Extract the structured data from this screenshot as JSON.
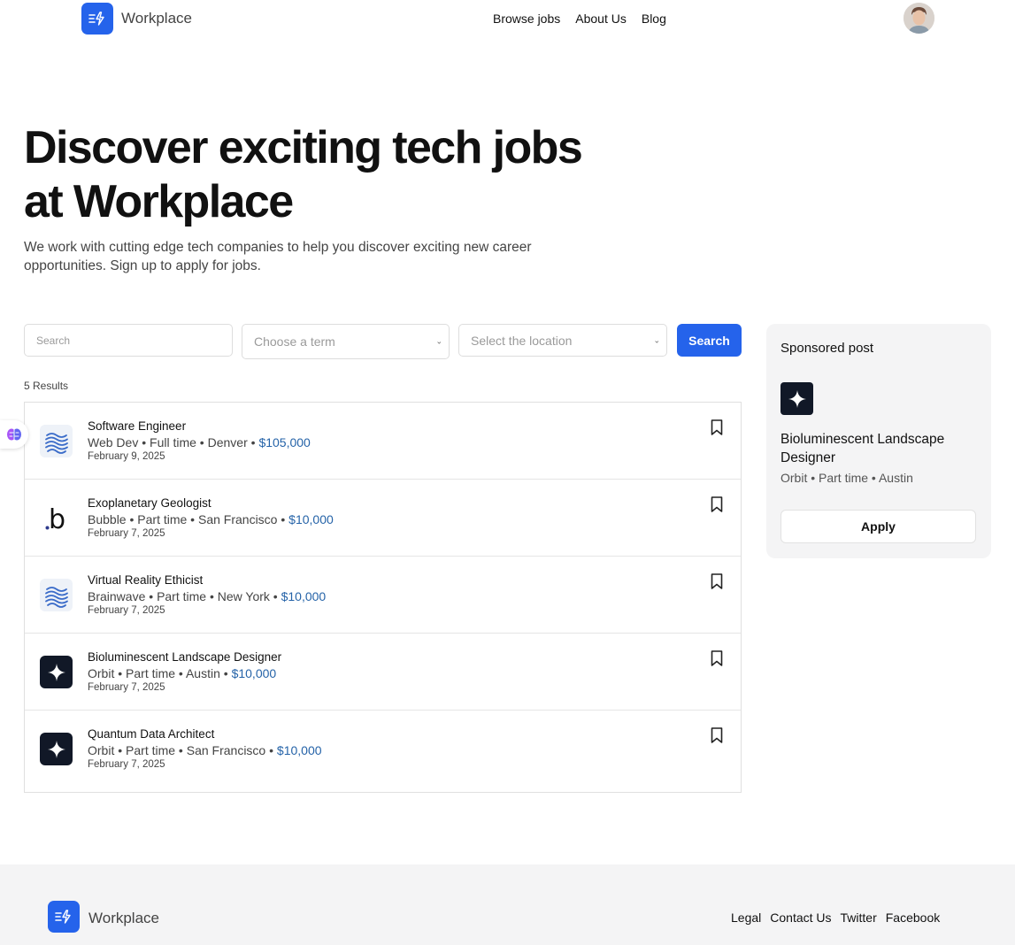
{
  "header": {
    "brand": "Workplace",
    "nav": [
      "Browse jobs",
      "About Us",
      "Blog"
    ]
  },
  "hero": {
    "title_line1": "Discover exciting tech jobs",
    "title_line2": "at Workplace",
    "subtitle": "We work with cutting edge tech companies to help you discover exciting new career opportunities. Sign up to apply for jobs."
  },
  "search": {
    "placeholder": "Search",
    "term_placeholder": "Choose a term",
    "location_placeholder": "Select the location",
    "button_label": "Search"
  },
  "results": {
    "count_label": "5 Results"
  },
  "jobs": [
    {
      "title": "Software Engineer",
      "company": "Web Dev",
      "type": "Full time",
      "location": "Denver",
      "salary": "$105,000",
      "date": "February 9, 2025",
      "logo": "wave-logo-icon"
    },
    {
      "title": "Exoplanetary Geologist",
      "company": "Bubble",
      "type": "Part time",
      "location": "San Francisco",
      "salary": "$10,000",
      "date": "February 7, 2025",
      "logo": "bubble-logo-icon"
    },
    {
      "title": "Virtual Reality Ethicist",
      "company": "Brainwave",
      "type": "Part time",
      "location": "New York",
      "salary": "$10,000",
      "date": "February 7, 2025",
      "logo": "wave-logo-icon"
    },
    {
      "title": "Bioluminescent Landscape Designer",
      "company": "Orbit",
      "type": "Part time",
      "location": "Austin",
      "salary": "$10,000",
      "date": "February 7, 2025",
      "logo": "star-logo-icon"
    },
    {
      "title": "Quantum Data Architect",
      "company": "Orbit",
      "type": "Part time",
      "location": "San Francisco",
      "salary": "$10,000",
      "date": "February 7, 2025",
      "logo": "star-logo-icon"
    }
  ],
  "sponsored": {
    "heading": "Sponsored post",
    "title": "Bioluminescent Landscape Designer",
    "meta": "Orbit • Part time • Austin",
    "apply_label": "Apply"
  },
  "footer": {
    "brand": "Workplace",
    "links": [
      "Legal",
      "Contact Us",
      "Twitter",
      "Facebook"
    ]
  },
  "colors": {
    "accent": "#2563eb",
    "salary": "#2563a8",
    "star_logo_bg": "#111827"
  }
}
